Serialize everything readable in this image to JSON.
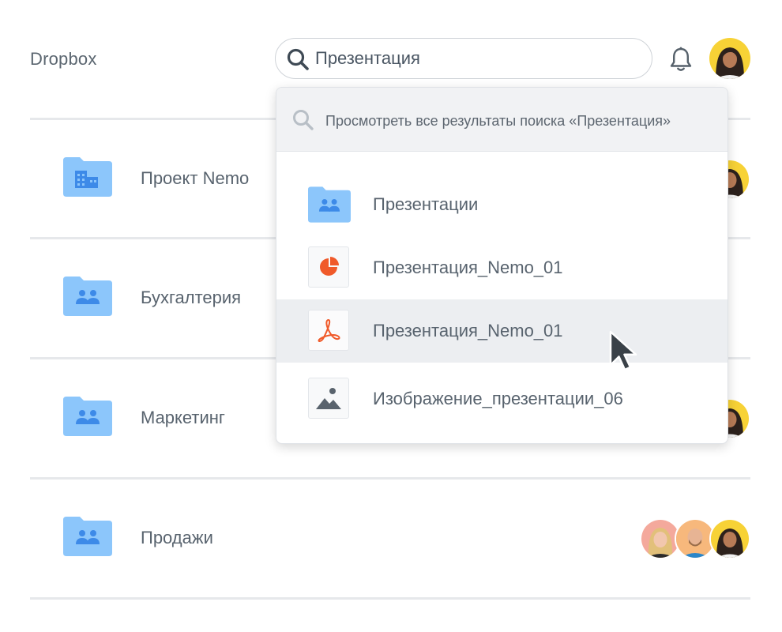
{
  "app": {
    "name": "Dropbox"
  },
  "search": {
    "value": "Презентация"
  },
  "header_icons": [
    "search-icon",
    "bell-icon",
    "user-avatar"
  ],
  "folders": [
    {
      "name": "Проект Nemo",
      "icon": "building-folder-icon"
    },
    {
      "name": "Бухгалтерия",
      "icon": "shared-folder-icon"
    },
    {
      "name": "Маркетинг",
      "icon": "shared-folder-icon"
    },
    {
      "name": "Продажи",
      "icon": "shared-folder-icon"
    }
  ],
  "dropdown": {
    "view_all": "Просмотреть все результаты поиска «Презентация»",
    "results": [
      {
        "name": "Презентации",
        "icon": "shared-folder-icon"
      },
      {
        "name": "Презентация_Nemo_01",
        "icon": "pie-chart-file-icon"
      },
      {
        "name": "Презентация_Nemo_01",
        "icon": "pdf-file-icon",
        "highlighted": true
      },
      {
        "name": "Изображение_презентации_06",
        "icon": "image-file-icon"
      }
    ]
  },
  "colors": {
    "folder": "#8cc6fb",
    "folder_glyph": "#3d8ae8",
    "pie_chart": "#f05a2a",
    "pdf": "#f05a2a",
    "text": "#58636e",
    "avatar_yellow": "#f7d236"
  }
}
